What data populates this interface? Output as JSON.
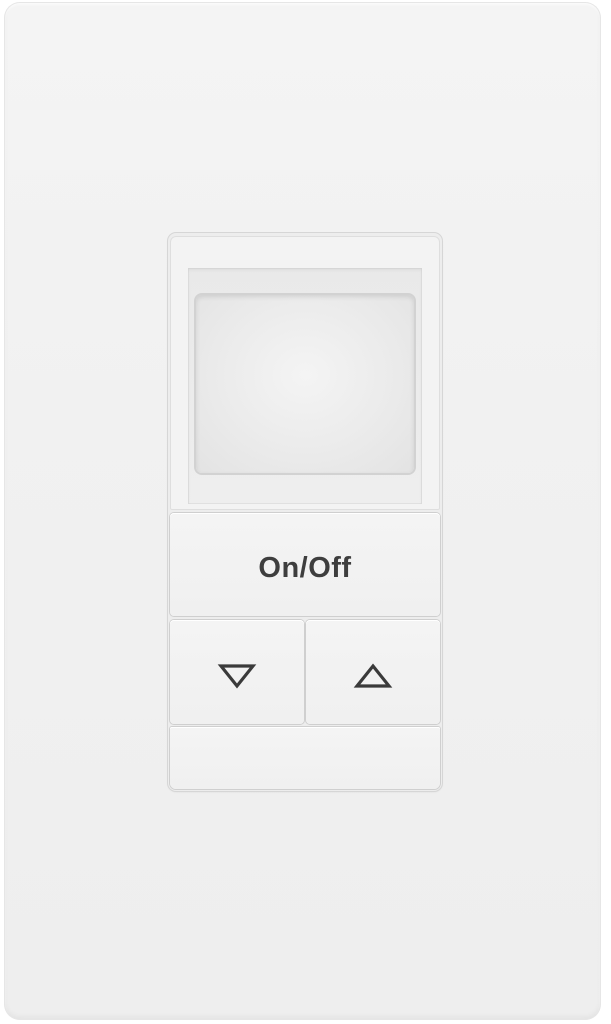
{
  "device": {
    "buttons": {
      "onoff_label": "On/Off",
      "down_icon": "triangle-down-outline-icon",
      "up_icon": "triangle-up-outline-icon"
    },
    "colors": {
      "plate": "#f1f1f1",
      "label": "#3e3e3e",
      "edge": "#cfcfcf"
    }
  }
}
